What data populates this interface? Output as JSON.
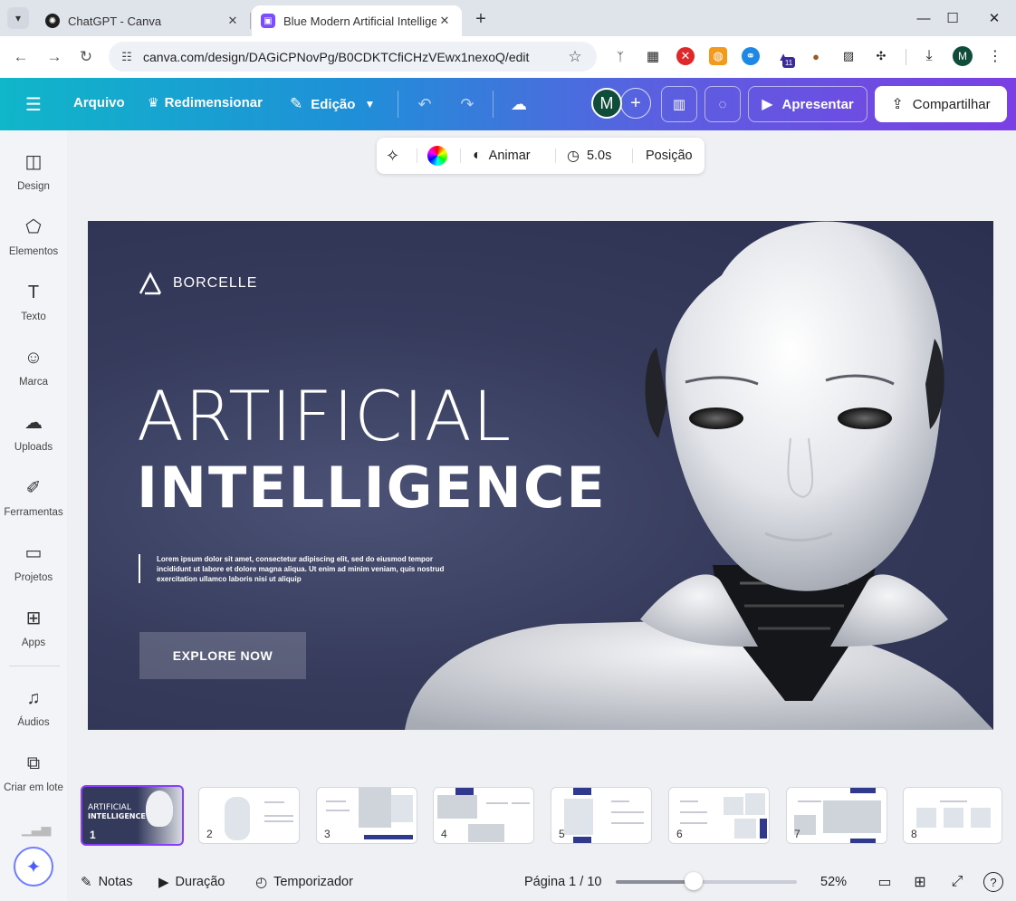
{
  "browser": {
    "tabs": [
      {
        "title": "ChatGPT - Canva",
        "active": false
      },
      {
        "title": "Blue Modern Artificial Intelligen",
        "active": true
      }
    ],
    "url": "canva.com/design/DAGiCPNovPg/B0CDKTCfiCHzVEwx1nexoQ/edit",
    "extension_badge": "11",
    "profile_initial": "M"
  },
  "header": {
    "file_label": "Arquivo",
    "resize_label": "Redimensionar",
    "edit_label": "Edição",
    "avatar_initial": "M",
    "present_label": "Apresentar",
    "share_label": "Compartilhar",
    "accent_gradient": [
      "#10b6c9",
      "#7b3fe4"
    ]
  },
  "sidebar": {
    "items": [
      {
        "label": "Design",
        "icon": "layout-icon"
      },
      {
        "label": "Elementos",
        "icon": "shapes-icon"
      },
      {
        "label": "Texto",
        "icon": "text-icon"
      },
      {
        "label": "Marca",
        "icon": "brand-icon"
      },
      {
        "label": "Uploads",
        "icon": "upload-cloud-icon"
      },
      {
        "label": "Ferramentas",
        "icon": "pen-tool-icon"
      },
      {
        "label": "Projetos",
        "icon": "folder-icon"
      },
      {
        "label": "Apps",
        "icon": "apps-grid-icon"
      },
      {
        "label": "Áudios",
        "icon": "music-note-icon"
      },
      {
        "label": "Criar em lote",
        "icon": "batch-create-icon"
      }
    ]
  },
  "context_toolbar": {
    "animate_label": "Animar",
    "duration_label": "5.0s",
    "position_label": "Posição"
  },
  "slide": {
    "brand_name": "BORCELLE",
    "title_line1": "ARTIFICIAL",
    "title_line2": "INTELLIGENCE",
    "body_text": "Lorem ipsum dolor sit amet, consectetur adipiscing elit, sed do eiusmod tempor incididunt ut labore et dolore magna aliqua. Ut enim ad minim veniam, quis nostrud exercitation ullamco laboris nisi ut aliquip",
    "cta_label": "EXPLORE NOW",
    "background_color": "#343a5c"
  },
  "thumbnails": [
    {
      "number": "1",
      "title_line1": "ARTIFICIAL",
      "title_line2": "INTELLIGENCE",
      "active": true
    },
    {
      "number": "2",
      "active": false
    },
    {
      "number": "3",
      "active": false
    },
    {
      "number": "4",
      "active": false
    },
    {
      "number": "5",
      "active": false
    },
    {
      "number": "6",
      "active": false
    },
    {
      "number": "7",
      "active": false
    },
    {
      "number": "8",
      "active": false
    }
  ],
  "bottom_bar": {
    "notes_label": "Notas",
    "duration_label": "Duração",
    "timer_label": "Temporizador",
    "page_indicator": "Página 1 / 10",
    "zoom_percent": "52%",
    "zoom_slider_value": 0.43
  }
}
